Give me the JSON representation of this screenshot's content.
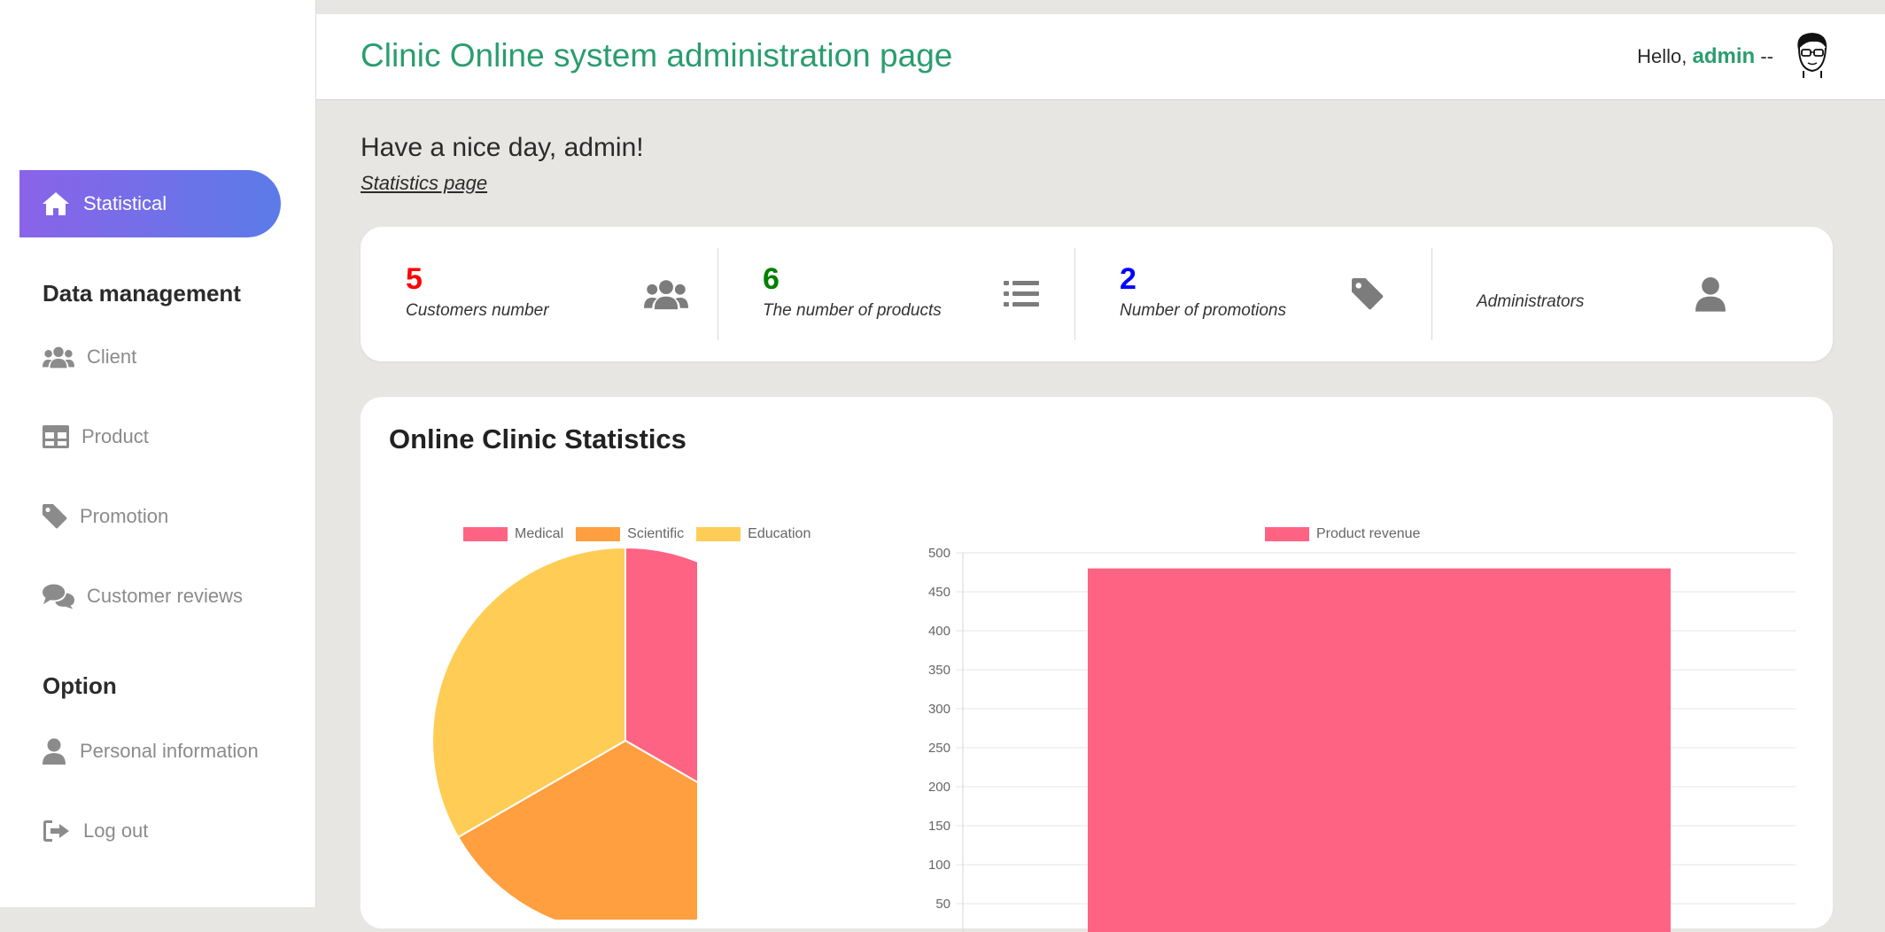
{
  "header": {
    "title": "Clinic Online system administration page",
    "greeting": "Hello,",
    "user": "admin",
    "suffix": "--"
  },
  "sidebar": {
    "active": {
      "label": "Statistical",
      "icon": "home-icon"
    },
    "sections": [
      {
        "title": "Data management",
        "items": [
          {
            "label": "Client",
            "icon": "users-icon"
          },
          {
            "label": "Product",
            "icon": "table-icon"
          },
          {
            "label": "Promotion",
            "icon": "tag-icon"
          },
          {
            "label": "Customer reviews",
            "icon": "comments-icon"
          }
        ]
      },
      {
        "title": "Option",
        "items": [
          {
            "label": "Personal information",
            "icon": "user-icon"
          },
          {
            "label": "Log out",
            "icon": "sign-out-icon"
          }
        ]
      }
    ]
  },
  "main": {
    "welcome": "Have a nice day, admin!",
    "breadcrumb": "Statistics page",
    "stats": [
      {
        "value": "5",
        "caption": "Customers number",
        "color": "#ff0000",
        "icon": "users-icon"
      },
      {
        "value": "6",
        "caption": "The number of products",
        "color": "#008000",
        "icon": "list-icon"
      },
      {
        "value": "2",
        "caption": "Number of promotions",
        "color": "#0000ff",
        "icon": "tag-icon"
      },
      {
        "value": "",
        "caption": "Administrators",
        "color": "#333333",
        "icon": "user-icon"
      }
    ],
    "chart_section_title": "Online Clinic Statistics"
  },
  "colors": {
    "accent": "#2a9d6f",
    "pink": "#ff6384",
    "orange": "#ff9f40",
    "yellow": "#ffcd56"
  },
  "chart_data": [
    {
      "type": "pie",
      "categories": [
        "Medical",
        "Scientific",
        "Education"
      ],
      "values": [
        1,
        1,
        1
      ],
      "colors": [
        "#ff6384",
        "#ff9f40",
        "#ffcd56"
      ],
      "legend": "top"
    },
    {
      "type": "bar",
      "categories": [
        ""
      ],
      "series": [
        {
          "name": "Product revenue",
          "values": [
            480
          ]
        }
      ],
      "ylim": [
        0,
        500
      ],
      "yticks": [
        0,
        50,
        100,
        150,
        200,
        250,
        300,
        350,
        400,
        450,
        500
      ],
      "grid": true,
      "legend": "top",
      "color": "#ff6384"
    }
  ]
}
